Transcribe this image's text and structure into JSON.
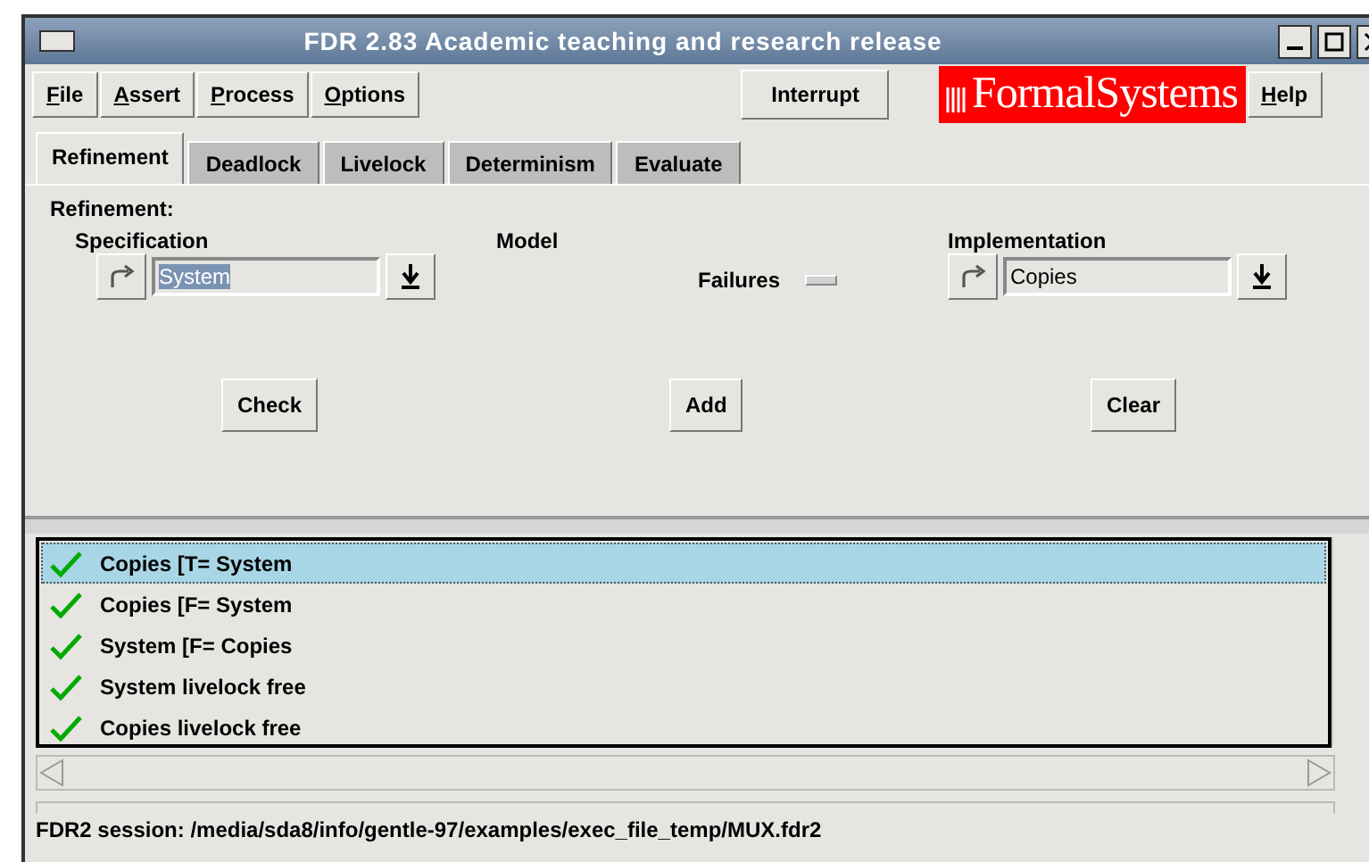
{
  "window": {
    "title": "FDR 2.83 Academic teaching and research release"
  },
  "menu": [
    {
      "label": "File",
      "mnemonic": true
    },
    {
      "label": "Assert",
      "mnemonic": true
    },
    {
      "label": "Process",
      "mnemonic": true
    },
    {
      "label": "Options",
      "mnemonic": true
    }
  ],
  "interrupt_button": "Interrupt",
  "logo": "FormalSystems",
  "help_menu": {
    "label": "Help",
    "mnemonic": true
  },
  "tabs": [
    {
      "label": "Refinement",
      "selected": true
    },
    {
      "label": "Deadlock",
      "selected": false
    },
    {
      "label": "Livelock",
      "selected": false
    },
    {
      "label": "Determinism",
      "selected": false
    },
    {
      "label": "Evaluate",
      "selected": false
    }
  ],
  "refinement": {
    "heading": "Refinement:",
    "specification": {
      "label": "Specification",
      "value": "System",
      "text_selected": true
    },
    "model": {
      "label": "Model",
      "value": "Failures"
    },
    "implementation": {
      "label": "Implementation",
      "value": "Copies",
      "text_selected": false
    },
    "buttons": [
      "Check",
      "Add",
      "Clear"
    ]
  },
  "results": [
    {
      "text": "Copies [T= System",
      "passed": true,
      "selected": true
    },
    {
      "text": "Copies [F= System",
      "passed": true,
      "selected": false
    },
    {
      "text": "System [F= Copies",
      "passed": true,
      "selected": false
    },
    {
      "text": "System livelock free",
      "passed": true,
      "selected": false
    },
    {
      "text": "Copies livelock free",
      "passed": true,
      "selected": false
    }
  ],
  "status_bar": "FDR2 session: /media/sda8/info/gentle-97/examples/exec_file_temp/MUX.fdr2"
}
